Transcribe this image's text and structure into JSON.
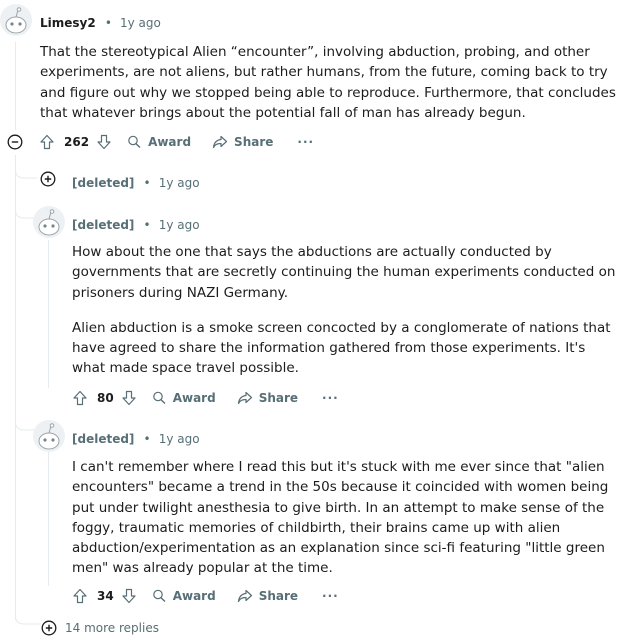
{
  "top_comment": {
    "author": "Limesy2",
    "time": "1y ago",
    "body": "That the stereotypical Alien “encounter”, involving abduction, probing, and other experiments, are not aliens, but rather humans, from the future, coming back to try and figure out why we stopped being able to reproduce. Furthermore, that concludes that whatever brings about the potential fall of man has already begun.",
    "votes": "262",
    "award_label": "Award",
    "share_label": "Share",
    "more_label": "···"
  },
  "replies": [
    {
      "author": "[deleted]",
      "time": "1y ago",
      "collapsed": true
    },
    {
      "author": "[deleted]",
      "time": "1y ago",
      "paragraphs": [
        "How about the one that says the abductions are actually conducted by governments that are secretly continuing the human experiments conducted on prisoners during NAZI Germany.",
        "Alien abduction is a smoke screen concocted by a conglomerate of nations that have agreed to share the information gathered from those experiments. It's what made space travel possible."
      ],
      "votes": "80",
      "award_label": "Award",
      "share_label": "Share",
      "more_label": "···"
    },
    {
      "author": "[deleted]",
      "time": "1y ago",
      "paragraphs": [
        "I can't remember where I read this but it's stuck with me ever since that \"alien encounters\" became a trend in the 50s because it coincided with women being put under twilight anesthesia to give birth. In an attempt to make sense of the foggy, traumatic memories of childbirth, their brains came up with alien abduction/experimentation as an explanation since sci-fi featuring \"little green men\" was already popular at the time."
      ],
      "votes": "34",
      "award_label": "Award",
      "share_label": "Share",
      "more_label": "···"
    }
  ],
  "more_replies_label": "14 more replies",
  "separator": "•",
  "icons": {
    "avatar": "snoo-avatar-icon",
    "upvote": "arrow-up-icon",
    "downvote": "arrow-down-icon",
    "award": "award-icon",
    "share": "share-icon",
    "collapse": "minus-circle-icon",
    "expand": "plus-circle-icon"
  },
  "colors": {
    "text": "#1c1c1c",
    "meta": "#576f76",
    "thread_line": "#e5ebee"
  }
}
